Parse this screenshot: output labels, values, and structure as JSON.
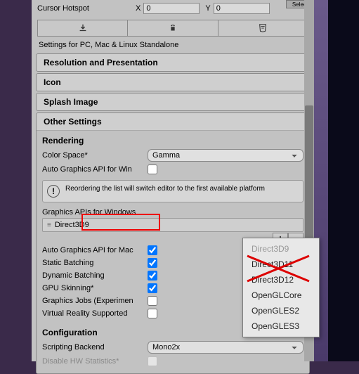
{
  "topbar": {
    "label": "Cursor Hotspot",
    "x_label": "X",
    "x_value": "0",
    "y_label": "Y",
    "y_value": "0",
    "select_btn": "Select"
  },
  "section_title": "Settings for PC, Mac & Linux Standalone",
  "accordion": {
    "resolution": "Resolution and Presentation",
    "icon": "Icon",
    "splash": "Splash Image",
    "other": "Other Settings"
  },
  "rendering": {
    "header": "Rendering",
    "color_space_label": "Color Space*",
    "color_space_value": "Gamma",
    "auto_api_win_label": "Auto Graphics API for Win",
    "info": "Reordering the list will switch editor to the first available platform",
    "list_label": "Graphics APIs for Windows",
    "api_item": "Direct3D9",
    "plus": "+",
    "minus": "−",
    "auto_api_mac_label": "Auto Graphics API for Mac",
    "static_batching": "Static Batching",
    "dynamic_batching": "Dynamic Batching",
    "gpu_skinning": "GPU Skinning*",
    "graphics_jobs": "Graphics Jobs (Experimen",
    "vr_supported": "Virtual Reality Supported"
  },
  "configuration": {
    "header": "Configuration",
    "scripting_backend_label": "Scripting Backend",
    "scripting_backend_value": "Mono2x",
    "disable_hw_stats": "Disable HW Statistics*"
  },
  "popup": {
    "items": [
      "Direct3D9",
      "Direct3D11",
      "Direct3D12",
      "OpenGLCore",
      "OpenGLES2",
      "OpenGLES3"
    ]
  }
}
